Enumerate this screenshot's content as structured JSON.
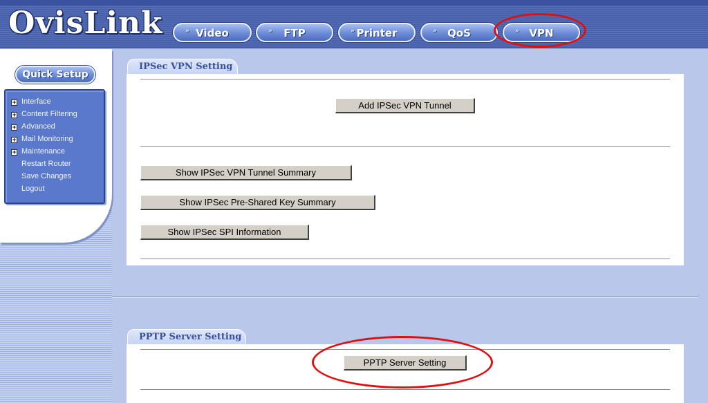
{
  "logo": "OvisLink",
  "tabs": [
    {
      "label": "Video",
      "icon": "double-chevron-icon"
    },
    {
      "label": "FTP",
      "icon": "double-chevron-icon"
    },
    {
      "label": "Printer",
      "icon": "double-chevron-icon"
    },
    {
      "label": "QoS",
      "icon": "double-chevron-icon"
    },
    {
      "label": "VPN",
      "icon": "double-chevron-icon",
      "highlighted": true
    }
  ],
  "sidebar": {
    "quick_setup": "Quick Setup",
    "items": [
      {
        "label": "Interface",
        "expandable": true
      },
      {
        "label": "Content Filtering",
        "expandable": true
      },
      {
        "label": "Advanced",
        "expandable": true
      },
      {
        "label": "Mail Monitoring",
        "expandable": true
      },
      {
        "label": "Maintenance",
        "expandable": true
      },
      {
        "label": "Restart Router",
        "expandable": false
      },
      {
        "label": "Save Changes",
        "expandable": false
      },
      {
        "label": "Logout",
        "expandable": false
      }
    ]
  },
  "ipsec": {
    "title": "IPSec VPN Setting",
    "add_button": "Add IPSec VPN Tunnel",
    "summary_button": "Show IPSec VPN Tunnel Summary",
    "psk_button": "Show IPSec Pre-Shared Key Summary",
    "spi_button": "Show IPSec SPI Information"
  },
  "pptp": {
    "title": "PPTP Server Setting",
    "button": "PPTP Server Setting",
    "highlighted": true
  },
  "colors": {
    "header": "#4a62ac",
    "highlight_circle": "#e01010",
    "content_bg": "#b9c8ea",
    "button_face": "#d4d0c8"
  }
}
